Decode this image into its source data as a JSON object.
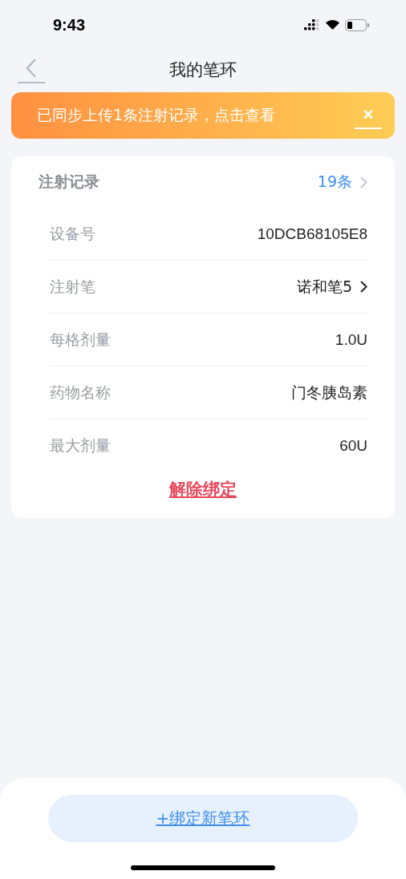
{
  "status_bar": {
    "time": "9:43"
  },
  "nav": {
    "title": "我的笔环"
  },
  "banner": {
    "text": "已同步上传1条注射记录，点击查看",
    "close": "×"
  },
  "card": {
    "header": {
      "label": "注射记录",
      "value": "19条"
    },
    "rows": [
      {
        "kind": "text",
        "label": "设备号",
        "value": "10DCB68105E8"
      },
      {
        "kind": "link",
        "label": "注射笔",
        "value": "诺和笔5"
      },
      {
        "kind": "text",
        "label": "每格剂量",
        "value": "1.0U"
      },
      {
        "kind": "text",
        "label": "药物名称",
        "value": "门冬胰岛素"
      },
      {
        "kind": "text",
        "label": "最大剂量",
        "value": "60U"
      }
    ],
    "unbind": "解除绑定"
  },
  "bind_button": "+绑定新笔环"
}
